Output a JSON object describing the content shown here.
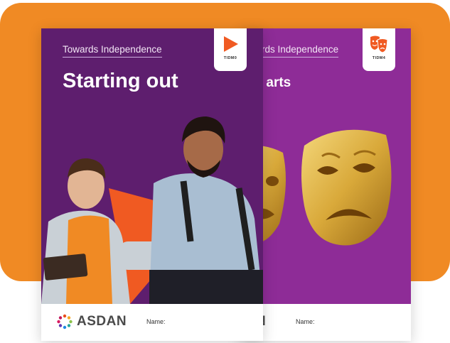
{
  "books": [
    {
      "series": "Towards Independence",
      "title": "Starting out",
      "icon": "play-icon",
      "badge_code": "TIDM0",
      "footer_brand": "ASDAN",
      "footer_name_label": "Name:"
    },
    {
      "series": "ntowards Independence",
      "title": "hing arts",
      "icon": "theatre-masks-icon",
      "badge_code": "TIDM4",
      "footer_brand_fragment": "N",
      "footer_name_label": "Name:"
    }
  ],
  "colors": {
    "background_panel": "#f08a24",
    "front_cover": "#5e1e6e",
    "back_cover": "#8e2c97",
    "accent_orange": "#f05a22",
    "mask_gold": "#d9a93a"
  }
}
